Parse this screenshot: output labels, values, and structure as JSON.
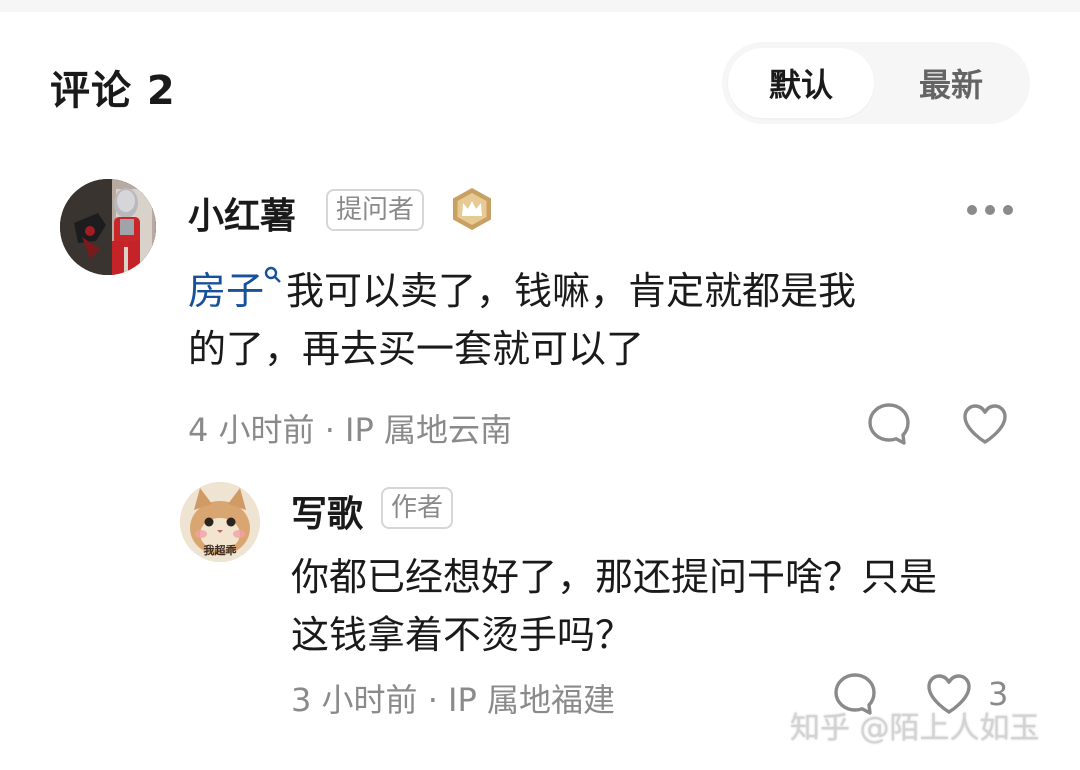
{
  "header": {
    "title": "评论 2",
    "sort_default": "默认",
    "sort_latest": "最新"
  },
  "comments": [
    {
      "author": "小红薯",
      "role_tag": "提问者",
      "badge_icon": "crown-badge-icon",
      "link_text": "房子",
      "text_line1": "我可以卖了，钱嘛，肯定就都是我",
      "text_line2": "的了，再去买一套就可以了",
      "meta": "4 小时前 · IP 属地云南"
    }
  ],
  "reply": {
    "author": "写歌",
    "role_tag": "作者",
    "avatar_caption": "我超乖",
    "text_line1": "你都已经想好了，那还提问干啥？只是",
    "text_line2": "这钱拿着不烫手吗？",
    "meta": "3 小时前 · IP 属地福建",
    "like_count": "3"
  },
  "watermark": "知乎 @陌上人如玉",
  "colors": {
    "link": "#175199",
    "muted": "#8a8a8a",
    "badge_gold": "#c9a064"
  }
}
